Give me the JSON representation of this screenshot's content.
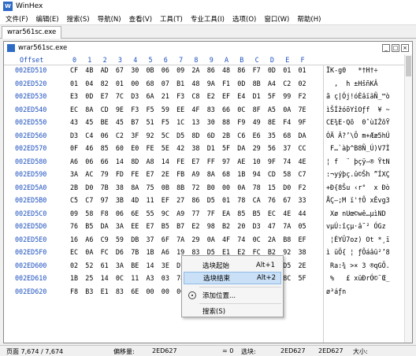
{
  "app": {
    "title": "WinHex"
  },
  "menubar": [
    "文件(F)",
    "编辑(E)",
    "搜索(S)",
    "导航(N)",
    "查看(V)",
    "工具(T)",
    "专业工具(I)",
    "选项(O)",
    "窗口(W)",
    "帮助(H)"
  ],
  "tabs": [
    {
      "label": "wrar561sc.exe"
    }
  ],
  "child": {
    "title": "wrar561sc.exe"
  },
  "hex": {
    "header_offset": "Offset",
    "header_cols": [
      "0",
      "1",
      "2",
      "3",
      "4",
      "5",
      "6",
      "7",
      "8",
      "9",
      "A",
      "B",
      "C",
      "D",
      "E",
      "F"
    ],
    "rows": [
      {
        "offset": "002ED510",
        "bytes": [
          "CF",
          "4B",
          "AD",
          "67",
          "30",
          "0B",
          "06",
          "09",
          "2A",
          "86",
          "48",
          "86",
          "F7",
          "0D",
          "01",
          "01"
        ],
        "text": "ÏK-g0   *†H†÷"
      },
      {
        "offset": "002ED520",
        "bytes": [
          "01",
          "04",
          "82",
          "01",
          "00",
          "68",
          "07",
          "B1",
          "48",
          "9A",
          "F1",
          "0D",
          "8B",
          "A4",
          "C2",
          "02"
        ],
        "text": "  ‚  h ±HšñKÂ"
      },
      {
        "offset": "002ED530",
        "bytes": [
          "E3",
          "0D",
          "E7",
          "7C",
          "D3",
          "6A",
          "21",
          "F3",
          "C8",
          "E2",
          "EF",
          "E4",
          "D1",
          "5F",
          "99",
          "F2"
        ],
        "text": "ã ç|Ój!óÈâïäÑ_™ò"
      },
      {
        "offset": "002ED540",
        "bytes": [
          "EC",
          "8A",
          "CD",
          "9E",
          "F3",
          "F5",
          "59",
          "EE",
          "4F",
          "83",
          "66",
          "0C",
          "8F",
          "A5",
          "0A",
          "7E"
        ],
        "text": "ìŠÍžóõYîOƒf  ¥ ~"
      },
      {
        "offset": "002ED550",
        "bytes": [
          "43",
          "45",
          "BE",
          "45",
          "B7",
          "51",
          "F5",
          "1C",
          "13",
          "30",
          "88",
          "F9",
          "49",
          "8E",
          "F4",
          "9F"
        ],
        "text": "CE¾E·Qõ  0ˆùIŽôŸ"
      },
      {
        "offset": "002ED560",
        "bytes": [
          "D3",
          "C4",
          "06",
          "C2",
          "3F",
          "92",
          "5C",
          "D5",
          "8D",
          "6D",
          "2B",
          "C6",
          "E6",
          "35",
          "68",
          "DA"
        ],
        "text": "ÓÄ Â?’\\Õ m+Ææ5hÚ"
      },
      {
        "offset": "002ED570",
        "bytes": [
          "0F",
          "46",
          "85",
          "60",
          "E0",
          "FE",
          "5E",
          "42",
          "38",
          "D1",
          "5F",
          "DA",
          "29",
          "56",
          "37",
          "CC"
        ],
        "text": " F…`àþ^B8Ñ_Ú)V7Ì"
      },
      {
        "offset": "002ED580",
        "bytes": [
          "A6",
          "06",
          "66",
          "14",
          "8D",
          "A8",
          "14",
          "FE",
          "E7",
          "FF",
          "97",
          "AE",
          "10",
          "9F",
          "74",
          "4E"
        ],
        "text": "¦ f  ¨ þçÿ—® ŸtN"
      },
      {
        "offset": "002ED590",
        "bytes": [
          "3A",
          "AC",
          "79",
          "FD",
          "FE",
          "E7",
          "2E",
          "FB",
          "A9",
          "8A",
          "68",
          "1B",
          "94",
          "CD",
          "58",
          "C7"
        ],
        "text": ":¬yýþç.û©Šh ”ÍXÇ"
      },
      {
        "offset": "002ED5A0",
        "bytes": [
          "2B",
          "D0",
          "7B",
          "38",
          "8A",
          "75",
          "0B",
          "8B",
          "72",
          "B0",
          "00",
          "0A",
          "78",
          "15",
          "D0",
          "F2"
        ],
        "text": "+Ð{8Šu ‹r°  x Ðò"
      },
      {
        "offset": "002ED5B0",
        "bytes": [
          "C5",
          "C7",
          "97",
          "3B",
          "4D",
          "11",
          "EF",
          "27",
          "86",
          "D5",
          "01",
          "78",
          "CA",
          "76",
          "67",
          "33"
        ],
        "text": "ÅÇ—;M ï'†Õ xÊvg3"
      },
      {
        "offset": "002ED5C0",
        "bytes": [
          "09",
          "58",
          "F8",
          "06",
          "6E",
          "55",
          "9C",
          "A9",
          "77",
          "7F",
          "EA",
          "85",
          "B5",
          "EC",
          "4E",
          "44"
        ],
        "text": " Xø nUœ©wê…µìND"
      },
      {
        "offset": "002ED5D0",
        "bytes": [
          "76",
          "B5",
          "DA",
          "3A",
          "EE",
          "E7",
          "B5",
          "B7",
          "E2",
          "98",
          "B2",
          "20",
          "D3",
          "47",
          "7A",
          "05"
        ],
        "text": "vµÚ:îçµ·â˜² ÓGz "
      },
      {
        "offset": "002ED5E0",
        "bytes": [
          "16",
          "A6",
          "C9",
          "59",
          "DB",
          "37",
          "6F",
          "7A",
          "29",
          "0A",
          "4F",
          "74",
          "0C",
          "2A",
          "B8",
          "EF"
        ],
        "text": " ¦ÉYÛ7oz) Ot *¸ï"
      },
      {
        "offset": "002ED5F0",
        "bytes": [
          "EC",
          "0A",
          "FC",
          "D6",
          "7B",
          "1B",
          "A6",
          "19",
          "83",
          "D5",
          "E1",
          "E2",
          "FC",
          "B2",
          "92",
          "38"
        ],
        "text": "ì üÖ{ ¦ ƒÕáâü²’8"
      },
      {
        "offset": "002ED600",
        "bytes": [
          "02",
          "52",
          "61",
          "3A",
          "BE",
          "14",
          "3E",
          "D7",
          "0F",
          "33",
          "13",
          "AE",
          "71",
          "47",
          "D5",
          "2E"
        ],
        "text": " Ra:¾ >× 3 ®qGÕ."
      },
      {
        "offset": "002ED610",
        "bytes": [
          "1B",
          "25",
          "14",
          "0C",
          "11",
          "A3",
          "03",
          "78",
          "FC",
          "D0",
          "72",
          "D3",
          "A9",
          "A8",
          "8C",
          "5F"
        ],
        "text": " %   £ xüÐrÓ©¨Œ_"
      },
      {
        "offset": "002ED620",
        "bytes": [
          "F8",
          "B3",
          "E1",
          "83",
          "6E",
          "00",
          "00",
          "00",
          "",
          "",
          "",
          "",
          "",
          "",
          "",
          ""
        ],
        "text": "ø³áƒn"
      }
    ]
  },
  "context_menu": {
    "items": [
      {
        "label": "选块起始",
        "shortcut": "Alt+1"
      },
      {
        "label": "选块结束",
        "shortcut": "Alt+2"
      },
      {
        "label": "添加位置...",
        "shortcut": ""
      },
      {
        "label": "搜索(S)",
        "shortcut": ""
      }
    ]
  },
  "status": {
    "page": "页面 7,674 / 7,674",
    "offset_label": "偏移量:",
    "offset_value": "2ED627",
    "eq": "= 0",
    "sel_label": "选块:",
    "sel_start": "2ED627",
    "sel_end": "2ED627",
    "size_label": "大小:"
  }
}
